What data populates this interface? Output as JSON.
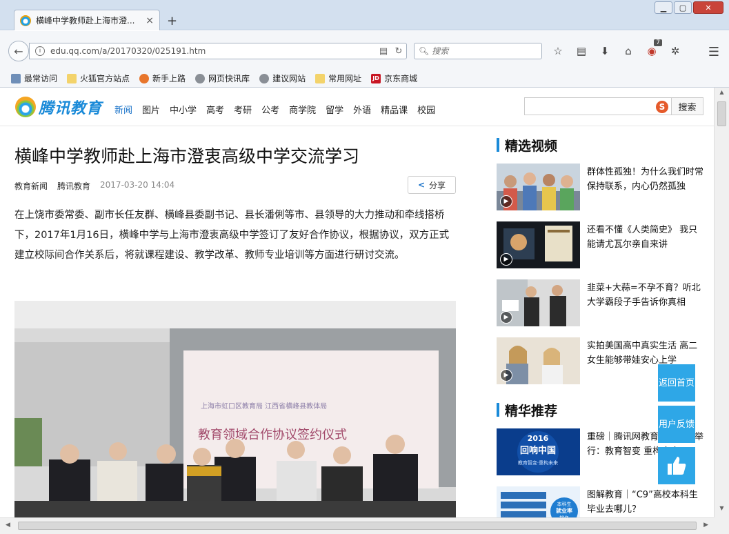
{
  "browser": {
    "tab_title": "横峰中学教师赴上海市澄...",
    "tab_close": "×",
    "new_tab": "+",
    "url": "edu.qq.com/a/20170320/025191.htm",
    "search_placeholder": "搜索",
    "addon_badge": "7",
    "bookmarks": [
      "最常访问",
      "火狐官方站点",
      "新手上路",
      "网页快讯库",
      "建议网站",
      "常用网址",
      "京东商城"
    ]
  },
  "site": {
    "logo_text": "腾讯教育",
    "nav": [
      "新闻",
      "图片",
      "中小学",
      "高考",
      "考研",
      "公考",
      "商学院",
      "留学",
      "外语",
      "精品课",
      "校园"
    ],
    "search_button": "搜索"
  },
  "article": {
    "title": "横峰中学教师赴上海市澄衷高级中学交流学习",
    "category": "教育新闻",
    "source": "腾讯教育",
    "date": "2017-03-20 14:04",
    "share_label": "分享",
    "body": "在上饶市委常委、副市长任友群、横峰县委副书记、县长潘俐等市、县领导的大力推动和牵线搭桥下，2017年1月16日，横峰中学与上海市澄衷高级中学签订了友好合作协议，根据协议，双方正式建立校际间合作关系后，将就课程建设、教学改革、教师专业培训等方面进行研讨交流。",
    "photo_banner_line1": "上海市虹口区教育局    江西省横峰县教体局",
    "photo_banner_line2": "教育领域合作协议签约仪式"
  },
  "sidebar": {
    "videos_title": "精选视频",
    "videos": [
      {
        "caption": "群体性孤独！为什么我们时常保持联系，内心仍然孤独"
      },
      {
        "caption": "还看不懂《人类简史》 我只能请尤瓦尔亲自来讲"
      },
      {
        "caption": "韭菜+大蒜=不孕不育？听北大学霸段子手告诉你真相"
      },
      {
        "caption": "实拍美国高中真实生活 高二女生能够带娃安心上学"
      }
    ],
    "recommend_title": "精华推荐",
    "recommend": [
      {
        "caption": "重磅｜腾讯网教育年度盛典举行：教育智变 重构未来",
        "thumb_text_1": "2016",
        "thumb_text_2": "回响中国",
        "thumb_text_3": "教育智变·重构未来"
      },
      {
        "caption": "图解教育｜“C9”高校本科生毕业去哪儿？",
        "thumb_text_1": "本科生",
        "thumb_text_2": "就业率",
        "thumb_text_3": "排名"
      }
    ]
  },
  "floating": {
    "back_top": "返回首页",
    "feedback": "用户反馈"
  },
  "colors": {
    "accent": "#1a8ad8",
    "float_button": "#2ea7e7"
  }
}
